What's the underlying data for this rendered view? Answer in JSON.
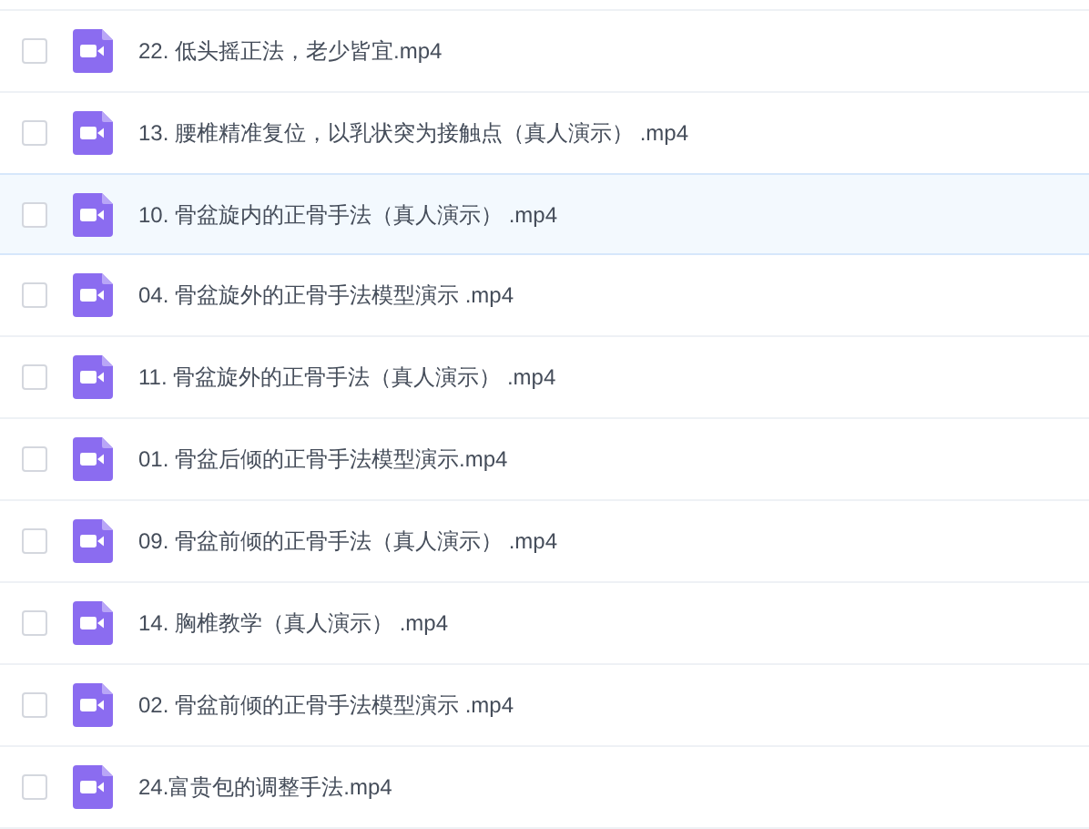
{
  "files": [
    {
      "name": "22. 低头摇正法，老少皆宜.mp4",
      "checked": false,
      "hovered": false
    },
    {
      "name": "13. 腰椎精准复位，以乳状突为接触点（真人演示） .mp4",
      "checked": false,
      "hovered": false
    },
    {
      "name": "10. 骨盆旋内的正骨手法（真人演示） .mp4",
      "checked": false,
      "hovered": true
    },
    {
      "name": "04. 骨盆旋外的正骨手法模型演示 .mp4",
      "checked": false,
      "hovered": false
    },
    {
      "name": "11. 骨盆旋外的正骨手法（真人演示） .mp4",
      "checked": false,
      "hovered": false
    },
    {
      "name": "01. 骨盆后倾的正骨手法模型演示.mp4",
      "checked": false,
      "hovered": false
    },
    {
      "name": "09. 骨盆前倾的正骨手法（真人演示） .mp4",
      "checked": false,
      "hovered": false
    },
    {
      "name": "14. 胸椎教学（真人演示） .mp4",
      "checked": false,
      "hovered": false
    },
    {
      "name": "02. 骨盆前倾的正骨手法模型演示 .mp4",
      "checked": false,
      "hovered": false
    },
    {
      "name": "24.富贵包的调整手法.mp4",
      "checked": false,
      "hovered": false
    }
  ]
}
